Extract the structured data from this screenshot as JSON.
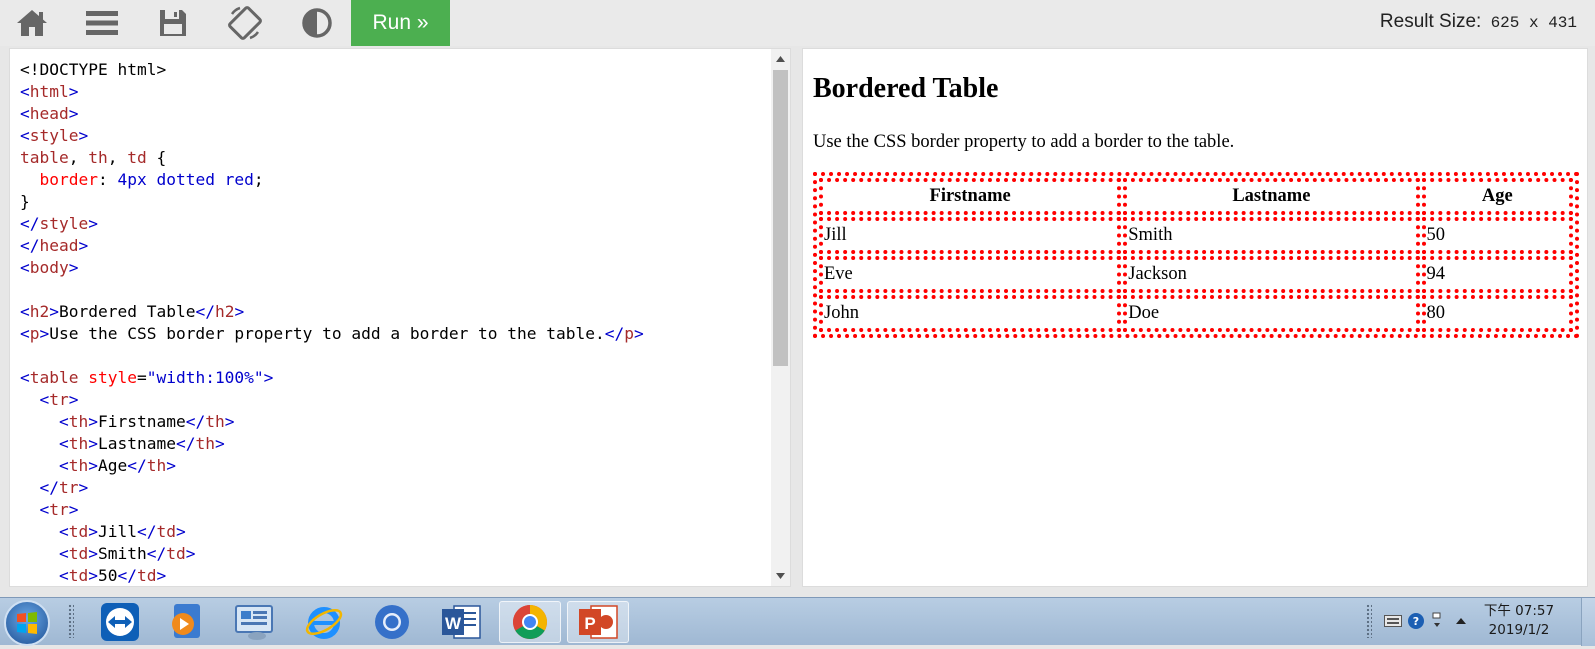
{
  "toolbar": {
    "run_label": "Run »",
    "result_size_label": "Result Size:",
    "result_size_value": "625 x 431",
    "icons": [
      "home-icon",
      "menu-icon",
      "save-icon",
      "rotate-icon",
      "contrast-icon"
    ]
  },
  "editor": {
    "lines": [
      "<!DOCTYPE html>",
      "<html>",
      "<head>",
      "<style>",
      "table, th, td {",
      "  border: 4px dotted red;",
      "}",
      "</style>",
      "</head>",
      "<body>",
      "",
      "<h2>Bordered Table</h2>",
      "<p>Use the CSS border property to add a border to the table.</p>",
      "",
      "<table style=\"width:100%\">",
      "  <tr>",
      "    <th>Firstname</th>",
      "    <th>Lastname</th>",
      "    <th>Age</th>",
      "  </tr>",
      "  <tr>",
      "    <td>Jill</td>",
      "    <td>Smith</td>",
      "    <td>50</td>"
    ]
  },
  "result": {
    "heading": "Bordered Table",
    "paragraph": "Use the CSS border property to add a border to the table.",
    "table": {
      "headers": [
        "Firstname",
        "Lastname",
        "Age"
      ],
      "rows": [
        [
          "Jill",
          "Smith",
          "50"
        ],
        [
          "Eve",
          "Jackson",
          "94"
        ],
        [
          "John",
          "Doe",
          "80"
        ]
      ]
    },
    "border_color": "#ff0000"
  },
  "taskbar": {
    "apps": [
      "teamviewer-icon",
      "media-player-icon",
      "control-panel-icon",
      "internet-explorer-icon",
      "chrome-canary-icon",
      "word-icon",
      "chrome-icon",
      "powerpoint-icon"
    ],
    "clock_time": "下午 07:57",
    "clock_date": "2019/1/2"
  },
  "colors": {
    "run_button": "#4caf50",
    "tag": "#0000cd",
    "tag_name": "#a52a2a",
    "attribute": "#ff0000"
  }
}
